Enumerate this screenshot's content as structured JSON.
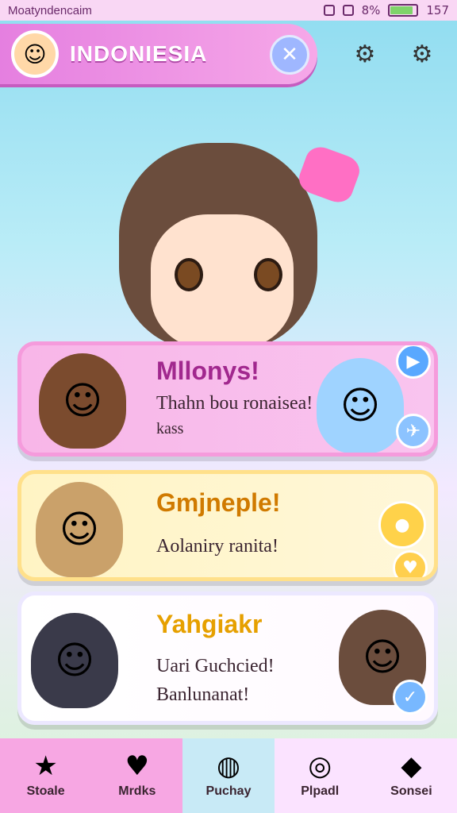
{
  "status": {
    "carrier": "Moatyndencaim",
    "battery_label": "8%",
    "time": "157",
    "battery_level": 0.85
  },
  "header": {
    "title": "INDONIESIA",
    "avatar_icon": "cute-face-icon",
    "action_icon": "sparkle-icon"
  },
  "topbar": {
    "icons": [
      "gear-icon",
      "settings-icon"
    ]
  },
  "cards": [
    {
      "title": "Mllonys!",
      "lines": [
        "Thahn bou ronaisea!",
        "kass"
      ],
      "title_color": "#a1288e"
    },
    {
      "title": "Gmjneple!",
      "lines": [
        "Aolaniry ranita!"
      ],
      "title_color": "#d07a00"
    },
    {
      "title": "Yahgiakr",
      "lines": [
        "Uari Guchcied!",
        "Banlunanat!"
      ],
      "title_color": "#e6a000"
    }
  ],
  "nav": {
    "items": [
      {
        "label": "Stoale",
        "icon": "star-icon"
      },
      {
        "label": "Mrdks",
        "icon": "heart-icon"
      },
      {
        "label": "Puchay",
        "icon": "bubble-icon"
      },
      {
        "label": "Plpadl",
        "icon": "ring-icon"
      },
      {
        "label": "Sonsei",
        "icon": "gem-icon"
      }
    ]
  },
  "colors": {
    "accent": "#e57fe0",
    "sky": "#8fdcf0"
  }
}
